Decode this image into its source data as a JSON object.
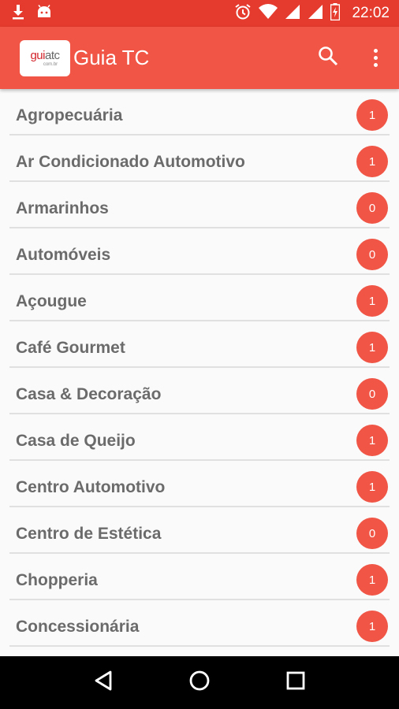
{
  "status_bar": {
    "time": "22:02",
    "left_icons": [
      "download-icon",
      "android-icon"
    ],
    "right_icons": [
      "alarm-icon",
      "wifi-icon",
      "signal-icon",
      "signal-icon",
      "battery-charging-icon"
    ]
  },
  "app_bar": {
    "logo": {
      "main_a": "gui",
      "main_b": "atc",
      "sub": "com.br"
    },
    "title": "Guia TC",
    "actions": [
      "search-icon",
      "more-vert-icon"
    ]
  },
  "colors": {
    "status_bar": "#e43b2e",
    "app_bar": "#f05545",
    "badge": "#f05545",
    "text": "#6b6b6b",
    "divider": "#e0e0e0"
  },
  "categories": [
    {
      "label": "Agropecuária",
      "count": "1"
    },
    {
      "label": "Ar Condicionado Automotivo",
      "count": "1"
    },
    {
      "label": "Armarinhos",
      "count": "0"
    },
    {
      "label": "Automóveis",
      "count": "0"
    },
    {
      "label": "Açougue",
      "count": "1"
    },
    {
      "label": "Café Gourmet",
      "count": "1"
    },
    {
      "label": "Casa & Decoração",
      "count": "0"
    },
    {
      "label": "Casa de Queijo",
      "count": "1"
    },
    {
      "label": "Centro Automotivo",
      "count": "1"
    },
    {
      "label": "Centro de Estética",
      "count": "0"
    },
    {
      "label": "Chopperia",
      "count": "1"
    },
    {
      "label": "Concessionária",
      "count": "1"
    }
  ],
  "nav_bar": [
    "back-icon",
    "home-icon",
    "recents-icon"
  ]
}
